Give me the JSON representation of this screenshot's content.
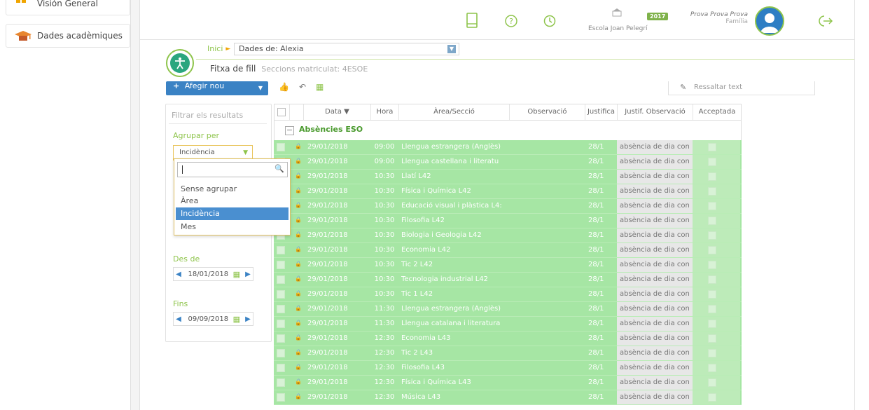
{
  "leftnav": {
    "items": [
      {
        "label": "Visión General"
      },
      {
        "label": "Dades acadèmiques"
      }
    ]
  },
  "header": {
    "school_year": "2017",
    "school_name": "Escola Joan Pelegrí",
    "user_name": "Prova Prova Prova",
    "user_role": "Família"
  },
  "breadcrumb": {
    "home": "Inici",
    "select_label": "Dades de:",
    "select_value": "Alexia"
  },
  "page": {
    "title": "Fitxa de fill",
    "subtitle": "Seccions matriculat: 4ESOE"
  },
  "toolbar": {
    "add_label": "Afegir nou",
    "highlight_label": "Ressaltar text"
  },
  "filters": {
    "search_placeholder": "Filtrar els resultats",
    "group_label": "Agrupar per",
    "group_value": "Incidència",
    "from_label": "Des de",
    "from_date": "18/01/2018",
    "to_label": "Fins",
    "to_date": "09/09/2018"
  },
  "dropdown": {
    "options": [
      "Sense agrupar",
      "Àrea",
      "Incidència",
      "Mes"
    ],
    "selected": "Incidència"
  },
  "grid": {
    "columns": [
      "Data ▼",
      "Hora",
      "Àrea/Secció",
      "Observació",
      "Justifica",
      "Justif. Observació",
      "Acceptada"
    ],
    "group_title": "Absències ESO",
    "rows": [
      {
        "date": "29/01/2018",
        "time": "09:00",
        "area": "Llengua estrangera (Anglès)",
        "just": "28/1",
        "obs": "absència de dia con"
      },
      {
        "date": "29/01/2018",
        "time": "09:00",
        "area": "Llengua castellana i literatu",
        "just": "28/1",
        "obs": "absència de dia con"
      },
      {
        "date": "29/01/2018",
        "time": "10:30",
        "area": "Llatí L42",
        "just": "28/1",
        "obs": "absència de dia con"
      },
      {
        "date": "29/01/2018",
        "time": "10:30",
        "area": "Física i Química L42",
        "just": "28/1",
        "obs": "absència de dia con"
      },
      {
        "date": "29/01/2018",
        "time": "10:30",
        "area": "Educació visual i plàstica L4:",
        "just": "28/1",
        "obs": "absència de dia con"
      },
      {
        "date": "29/01/2018",
        "time": "10:30",
        "area": "Filosofia L42",
        "just": "28/1",
        "obs": "absència de dia con"
      },
      {
        "date": "29/01/2018",
        "time": "10:30",
        "area": "Biologia i Geologia L42",
        "just": "28/1",
        "obs": "absència de dia con"
      },
      {
        "date": "29/01/2018",
        "time": "10:30",
        "area": "Economia L42",
        "just": "28/1",
        "obs": "absència de dia con"
      },
      {
        "date": "29/01/2018",
        "time": "10:30",
        "area": "Tic 2 L42",
        "just": "28/1",
        "obs": "absència de dia con"
      },
      {
        "date": "29/01/2018",
        "time": "10:30",
        "area": "Tecnologia industrial L42",
        "just": "28/1",
        "obs": "absència de dia con"
      },
      {
        "date": "29/01/2018",
        "time": "10:30",
        "area": "Tic 1 L42",
        "just": "28/1",
        "obs": "absència de dia con"
      },
      {
        "date": "29/01/2018",
        "time": "11:30",
        "area": "Llengua estrangera (Anglès)",
        "just": "28/1",
        "obs": "absència de dia con"
      },
      {
        "date": "29/01/2018",
        "time": "11:30",
        "area": "Llengua catalana i literatura",
        "just": "28/1",
        "obs": "absència de dia con"
      },
      {
        "date": "29/01/2018",
        "time": "12:30",
        "area": "Economia L43",
        "just": "28/1",
        "obs": "absència de dia con"
      },
      {
        "date": "29/01/2018",
        "time": "12:30",
        "area": "Tic 2 L43",
        "just": "28/1",
        "obs": "absència de dia con"
      },
      {
        "date": "29/01/2018",
        "time": "12:30",
        "area": "Filosofia L43",
        "just": "28/1",
        "obs": "absència de dia con"
      },
      {
        "date": "29/01/2018",
        "time": "12:30",
        "area": "Física i Química L43",
        "just": "28/1",
        "obs": "absència de dia con"
      },
      {
        "date": "29/01/2018",
        "time": "12:30",
        "area": "Música L43",
        "just": "28/1",
        "obs": "absència de dia con"
      }
    ]
  },
  "colors": {
    "accent_green": "#8ec44b",
    "row_green": "#a6e6a4",
    "primary_blue": "#3a82c4",
    "selected_option": "#4a8fd0"
  }
}
